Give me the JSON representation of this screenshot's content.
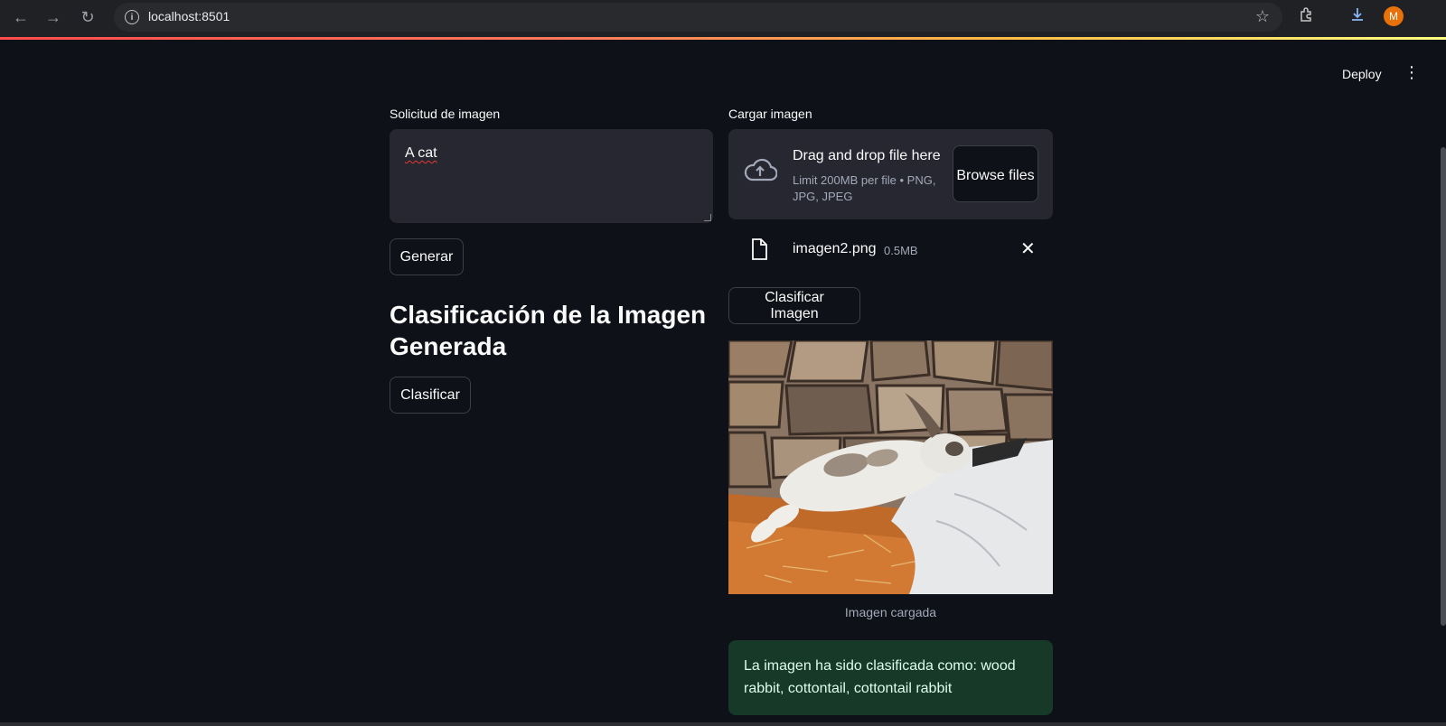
{
  "browser": {
    "url": "localhost:8501",
    "profile_initial": "M"
  },
  "app": {
    "deploy_label": "Deploy",
    "menu_glyph": "⋮"
  },
  "left": {
    "prompt_label": "Solicitud de imagen",
    "prompt_value": "A cat",
    "generate_label": "Generar",
    "heading": "Clasificación de la Imagen Generada",
    "classify_label": "Clasificar"
  },
  "right": {
    "upload_label": "Cargar imagen",
    "dropzone_title": "Drag and drop file here",
    "dropzone_subtitle": "Limit 200MB per file • PNG, JPG, JPEG",
    "browse_label": "Browse files",
    "file_name": "imagen2.png",
    "file_size": "0.5MB",
    "classify_image_label": "Clasificar Imagen",
    "image_caption": "Imagen cargada",
    "result_text": "La imagen ha sido clasificada como: wood rabbit, cottontail, cottontail rabbit"
  },
  "icons": {
    "back": "back-arrow-icon",
    "forward": "forward-arrow-icon",
    "reload": "reload-icon",
    "site_info": "info-icon",
    "bookmark": "star-icon",
    "extensions": "puzzle-icon",
    "downloads": "download-icon",
    "upload": "cloud-upload-icon",
    "file": "file-icon",
    "remove": "close-icon"
  },
  "colors": {
    "background": "#0e1117",
    "input_bg": "#262730",
    "success_bg": "#173928",
    "success_text": "#dffde9",
    "accent": "#ff4b4b"
  }
}
